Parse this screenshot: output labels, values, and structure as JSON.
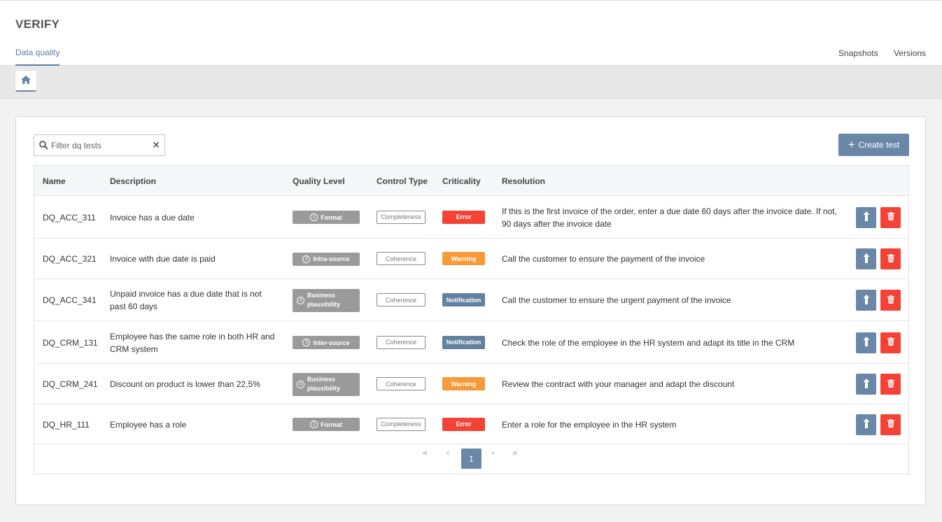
{
  "app": {
    "title": "VERIFY"
  },
  "tabs": {
    "data_quality": "Data quality",
    "snapshots": "Snapshots",
    "versions": "Versions"
  },
  "filter": {
    "placeholder": "Filter dq tests",
    "value": ""
  },
  "create_button": {
    "label": "Create test"
  },
  "columns": {
    "name": "Name",
    "description": "Description",
    "quality_level": "Quality Level",
    "control_type": "Control Type",
    "criticality": "Criticality",
    "resolution": "Resolution"
  },
  "rows": [
    {
      "name": "DQ_ACC_311",
      "description": [
        "Invoice has a due date"
      ],
      "quality_level": {
        "num": "1",
        "lines": [
          "Format"
        ]
      },
      "control_type": "Completeness",
      "criticality": "Error",
      "resolution": [
        "If this is the first invoice of the order, enter a due date 60 days after the invoice date. If not,",
        "90 days after the invoice date"
      ]
    },
    {
      "name": "DQ_ACC_321",
      "description": [
        "Invoice with due date is paid"
      ],
      "quality_level": {
        "num": "2",
        "lines": [
          "Intra-source"
        ]
      },
      "control_type": "Coherence",
      "criticality": "Warning",
      "resolution": [
        "Call the customer to ensure the payment of the invoice"
      ]
    },
    {
      "name": "DQ_ACC_341",
      "description": [
        "Unpaid invoice has a due date that is not",
        "past 60 days"
      ],
      "quality_level": {
        "num": "4",
        "lines": [
          "Business",
          "plausibility"
        ]
      },
      "control_type": "Coherence",
      "criticality": "Notification",
      "resolution": [
        "Call the customer to ensure the urgent payment of the invoice"
      ]
    },
    {
      "name": "DQ_CRM_131",
      "description": [
        "Employee has the same role in both HR and",
        "CRM system"
      ],
      "quality_level": {
        "num": "3",
        "lines": [
          "Inter-source"
        ]
      },
      "control_type": "Coherence",
      "criticality": "Notification",
      "resolution": [
        "Check the role of the employee in the HR system and adapt its title in the CRM"
      ]
    },
    {
      "name": "DQ_CRM_241",
      "description": [
        "Discount on product is lower than 22,5%"
      ],
      "quality_level": {
        "num": "4",
        "lines": [
          "Business",
          "plausibility"
        ]
      },
      "control_type": "Coherence",
      "criticality": "Warning",
      "resolution": [
        "Review the contract with your manager and adapt the discount"
      ]
    },
    {
      "name": "DQ_HR_111",
      "description": [
        "Employee has a role"
      ],
      "quality_level": {
        "num": "1",
        "lines": [
          "Format"
        ]
      },
      "control_type": "Completeness",
      "criticality": "Error",
      "resolution": [
        "Enter a role for the employee in the HR system"
      ]
    }
  ],
  "pagination": {
    "first": "«",
    "prev": "‹",
    "current": "1",
    "next": "›",
    "last": "»"
  },
  "colors": {
    "accent": "#6a87a8",
    "error": "#f44336",
    "warning": "#f59b3a",
    "notification": "#62809f",
    "quality_badge": "#9a9a9a"
  }
}
